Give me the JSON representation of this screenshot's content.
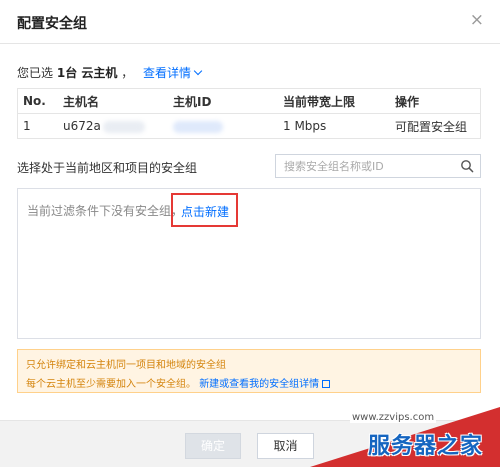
{
  "dialog": {
    "title": "配置安全组",
    "close_symbol": "×"
  },
  "selection": {
    "prefix": "您已选",
    "count_text": "1台 云主机",
    "suffix": "，",
    "details_link": "查看详情"
  },
  "host_table": {
    "headers": [
      "No.",
      "主机名",
      "主机ID",
      "当前带宽上限",
      "操作"
    ],
    "rows": [
      {
        "no": "1",
        "hostname": "u672a",
        "host_id": "",
        "bandwidth": "1 Mbps",
        "action": "可配置安全组"
      }
    ]
  },
  "security_group": {
    "label": "选择处于当前地区和项目的安全组",
    "search_placeholder": "搜索安全组名称或ID",
    "empty_text": "当前过滤条件下没有安全组，",
    "create_link": "点击新建"
  },
  "notice": {
    "line1": "只允许绑定和云主机同一项目和地域的安全组",
    "line2_prefix": "每个云主机至少需要加入一个安全组。",
    "line2_link": "新建或查看我的安全组详情"
  },
  "footer": {
    "ok_label": "确定",
    "cancel_label": "取消"
  },
  "watermark": {
    "url": "www.zzvips.com",
    "text": "服务器之家"
  },
  "colors": {
    "link": "#006eff",
    "highlight_border": "#e53935",
    "notice_bg": "#fff4e3",
    "notice_text": "#d4840c"
  }
}
